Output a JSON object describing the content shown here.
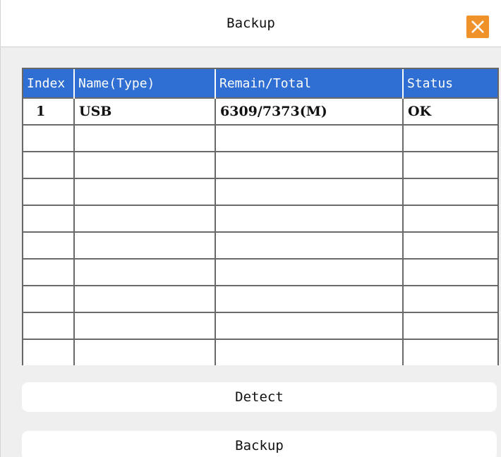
{
  "window": {
    "title": "Backup",
    "close_icon": "close-x-icon",
    "close_color": "#f0922a"
  },
  "table": {
    "header_color": "#2f6fd3",
    "columns": [
      "Index",
      "Name(Type)",
      "Remain/Total",
      "Status"
    ],
    "rows": [
      [
        "1",
        "USB",
        "6309/7373(M)",
        "OK"
      ],
      [
        "",
        "",
        "",
        ""
      ],
      [
        "",
        "",
        "",
        ""
      ],
      [
        "",
        "",
        "",
        ""
      ],
      [
        "",
        "",
        "",
        ""
      ],
      [
        "",
        "",
        "",
        ""
      ],
      [
        "",
        "",
        "",
        ""
      ],
      [
        "",
        "",
        "",
        ""
      ],
      [
        "",
        "",
        "",
        ""
      ],
      [
        "",
        "",
        "",
        ""
      ]
    ]
  },
  "buttons": {
    "detect_label": "Detect",
    "backup_label": "Backup"
  }
}
